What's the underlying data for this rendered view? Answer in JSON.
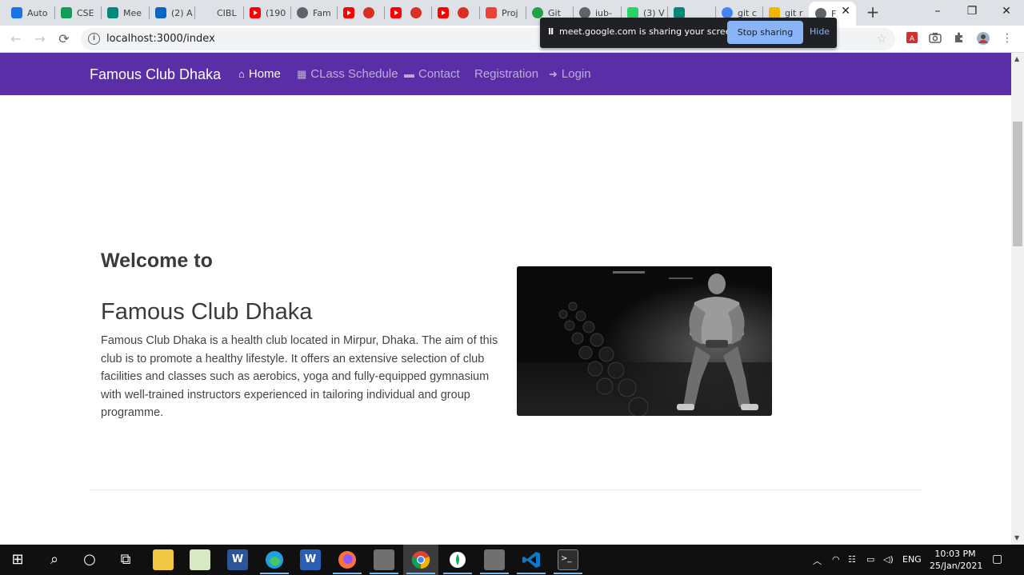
{
  "browser": {
    "tabs": [
      {
        "title": "Auto",
        "fav_color": "#1a73e8",
        "icon": "doc-icon"
      },
      {
        "title": "CSE",
        "fav_color": "#0f9d58",
        "icon": "sheets-icon"
      },
      {
        "title": "Mee",
        "fav_color": "#00897b",
        "icon": "meet-icon"
      },
      {
        "title": "(2) A",
        "fav_color": "#0a66c2",
        "icon": "linkedin-icon"
      },
      {
        "title": "CIBL",
        "fav_color": "",
        "icon": ""
      },
      {
        "title": "(190",
        "fav_color": "#ff0000",
        "icon": "youtube-icon"
      },
      {
        "title": "Fam",
        "fav_color": "#5f6368",
        "icon": "globe-icon"
      },
      {
        "title": "",
        "fav_color": "#ff0000",
        "icon": "youtube-icon"
      },
      {
        "title": "",
        "fav_color": "#ff0000",
        "icon": "youtube-icon"
      },
      {
        "title": "",
        "fav_color": "#ff0000",
        "icon": "youtube-icon"
      },
      {
        "title": "Proj",
        "fav_color": "#ea4335",
        "icon": "gmail-icon"
      },
      {
        "title": "Git",
        "fav_color": "#24a148",
        "icon": "github-icon"
      },
      {
        "title": "iub-",
        "fav_color": "#5f6368",
        "icon": "github-icon"
      },
      {
        "title": "(3) V",
        "fav_color": "#25d366",
        "icon": "whatsapp-icon"
      },
      {
        "title": "",
        "fav_color": "#00897b",
        "icon": "meet-icon"
      },
      {
        "title": "git c",
        "fav_color": "#4285f4",
        "icon": "google-icon"
      },
      {
        "title": "git r",
        "fav_color": "#f4b400",
        "icon": "git-icon"
      },
      {
        "title": "F",
        "fav_color": "#5f6368",
        "icon": "globe-icon"
      }
    ],
    "url": "localhost:3000/index",
    "window_controls": {
      "minimize": "–",
      "restore": "❐",
      "close": "✕"
    },
    "new_tab": "+"
  },
  "screen_share": {
    "message": "meet.google.com is sharing your screen.",
    "stop_label": "Stop sharing",
    "hide_label": "Hide",
    "pause_glyph": "II"
  },
  "site": {
    "brand": "Famous Club Dhaka",
    "nav": [
      {
        "label": "Home",
        "icon": "home-icon",
        "glyph": "⌂",
        "active": true
      },
      {
        "label": "CLass Schedule",
        "icon": "calendar-icon",
        "glyph": "▦",
        "active": false
      },
      {
        "label": "Contact",
        "icon": "id-card-icon",
        "glyph": "▬",
        "active": false
      },
      {
        "label": "Registration",
        "icon": "",
        "glyph": "",
        "active": false
      },
      {
        "label": "Login",
        "icon": "sign-in-icon",
        "glyph": "➜",
        "active": false
      }
    ],
    "hero": {
      "subtitle": "Welcome to",
      "title": "Famous Club Dhaka",
      "text": "Famous Club Dhaka is a health club located in Mirpur, Dhaka. The aim of this club is to promote a healthy lifestyle. It offers an extensive selection of club facilities and classes such as aerobics, yoga and fully-equipped gymnasium with well-trained instructors experienced in tailoring individual and group programme."
    }
  },
  "taskbar": {
    "apps": [
      "start-icon",
      "search-icon",
      "cortana-icon",
      "task-view-icon",
      "file-explorer-icon",
      "notepad-icon",
      "word-icon",
      "edge-icon",
      "wordpad-icon",
      "firefox-icon",
      "app-icon",
      "chrome-icon",
      "mongodb-icon",
      "app-icon",
      "vscode-icon",
      "terminal-icon"
    ],
    "tray": {
      "language": "ENG"
    },
    "time": "10:03 PM",
    "date": "25/Jan/2021"
  }
}
